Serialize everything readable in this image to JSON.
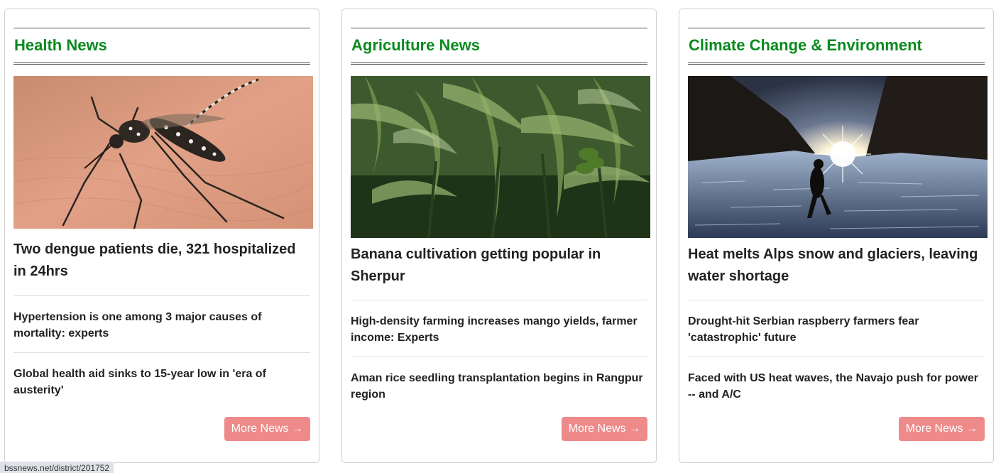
{
  "cards": [
    {
      "title": "Health News",
      "lead": "Two dengue patients die, 321 hospitalized in 24hrs",
      "items": [
        "Hypertension is one among 3 major causes of mortality: experts",
        "Global health aid sinks to 15-year low in 'era of austerity'"
      ],
      "more": "More News →",
      "image_icon": "mosquito-photo"
    },
    {
      "title": "Agriculture News",
      "lead": "Banana cultivation getting popular in Sherpur",
      "items": [
        "High-density farming increases mango yields, farmer income: Experts",
        "Aman rice seedling transplantation begins in Rangpur region"
      ],
      "more": "More News →",
      "image_icon": "banana-plants-photo"
    },
    {
      "title": "Climate Change & Environment",
      "lead": "Heat melts Alps snow and glaciers, leaving water shortage",
      "items": [
        "Drought-hit Serbian raspberry farmers fear 'catastrophic' future",
        "Faced with US heat waves, the Navajo push for power -- and A/C"
      ],
      "more": "More News →",
      "image_icon": "glacier-hiker-photo"
    }
  ],
  "status_bar": {
    "url": "bssnews.net/district/201752"
  },
  "colors": {
    "section_title": "#0a8a1f",
    "button_bg": "#ee8a8a",
    "headline_text": "#222222"
  }
}
